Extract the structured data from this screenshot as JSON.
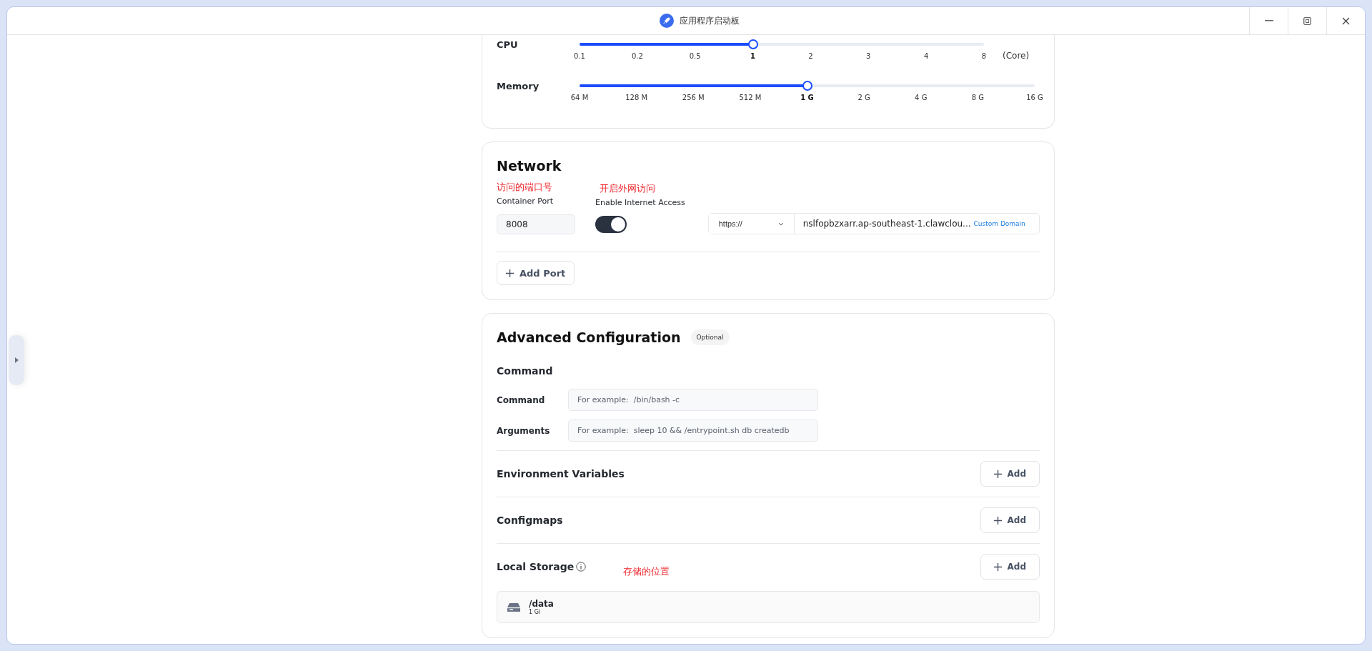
{
  "window": {
    "title": "应用程序启动板"
  },
  "resources": {
    "rows": [
      {
        "label": "CPU",
        "level": 0.4286,
        "unit": "(Core)",
        "ticks": [
          {
            "label": "0.1",
            "selected": false
          },
          {
            "label": "0.2",
            "selected": false
          },
          {
            "label": "0.5",
            "selected": false
          },
          {
            "label": "1",
            "selected": true
          },
          {
            "label": "2",
            "selected": false
          },
          {
            "label": "3",
            "selected": false
          },
          {
            "label": "4",
            "selected": false
          },
          {
            "label": "8",
            "selected": false
          }
        ]
      },
      {
        "label": "Memory",
        "level": 0.5,
        "ticks": [
          {
            "label": "64 M",
            "selected": false
          },
          {
            "label": "128 M",
            "selected": false
          },
          {
            "label": "256 M",
            "selected": false
          },
          {
            "label": "512 M",
            "selected": false
          },
          {
            "label": "1 G",
            "selected": true
          },
          {
            "label": "2 G",
            "selected": false
          },
          {
            "label": "4 G",
            "selected": false
          },
          {
            "label": "8 G",
            "selected": false
          },
          {
            "label": "16 G",
            "selected": false
          }
        ]
      }
    ]
  },
  "network": {
    "title": "Network",
    "port_annotation": "访问的端口号",
    "port_label": "Container Port",
    "port_value": "8008",
    "internet_annotation": "开启外网访问",
    "internet_label": "Enable Internet Access",
    "internet_on": true,
    "protocol": "https://",
    "domain": "nslfopbzxarr.ap-southeast-1.clawclou...",
    "custom_domain": "Custom Domain",
    "add_port": "Add Port"
  },
  "advanced": {
    "title": "Advanced Configuration",
    "badge": "Optional",
    "command_title": "Command",
    "fields": [
      {
        "label": "Command",
        "placeholder": "For example:  /bin/bash -c"
      },
      {
        "label": "Arguments",
        "placeholder": "For example:  sleep 10 && /entrypoint.sh db createdb"
      }
    ],
    "sections": [
      {
        "title": "Environment Variables",
        "button": "Add",
        "info": false
      },
      {
        "title": "Configmaps",
        "button": "Add",
        "info": false
      },
      {
        "title": "Local Storage",
        "button": "Add",
        "info": true,
        "annotation": "存储的位置"
      }
    ],
    "storage": [
      {
        "path": "/data",
        "size": "1 Gi"
      }
    ]
  }
}
